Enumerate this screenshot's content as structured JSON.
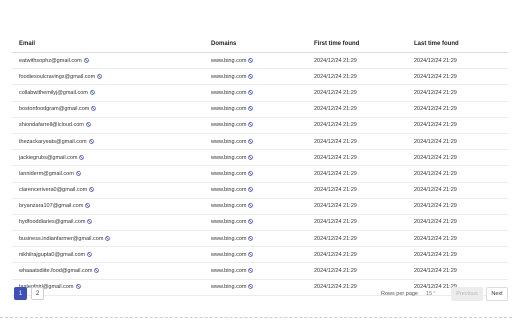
{
  "table": {
    "headers": {
      "email": "Email",
      "domains": "Domains",
      "first": "First time found",
      "last": "Last time found"
    },
    "rows": [
      {
        "email": "eatwithsophz@gmail.com",
        "domain": "www.bing.com",
        "first": "2024/12/24 21:29",
        "last": "2024/12/24 21:29"
      },
      {
        "email": "foodiesoulcravings@gmail.com",
        "domain": "www.bing.com",
        "first": "2024/12/24 21:29",
        "last": "2024/12/24 21:29"
      },
      {
        "email": "collabwithemilyj@gmail.com",
        "domain": "www.bing.com",
        "first": "2024/12/24 21:29",
        "last": "2024/12/24 21:29"
      },
      {
        "email": "bostonfoodgram@gmail.com",
        "domain": "www.bing.com",
        "first": "2024/12/24 21:29",
        "last": "2024/12/24 21:29"
      },
      {
        "email": "shiondafarrell@icloud.com",
        "domain": "www.bing.com",
        "first": "2024/12/24 21:29",
        "last": "2024/12/24 21:29"
      },
      {
        "email": "thezackaryeats@gmail.com",
        "domain": "www.bing.com",
        "first": "2024/12/24 21:29",
        "last": "2024/12/24 21:29"
      },
      {
        "email": "jackiegrubs@gmail.com",
        "domain": "www.bing.com",
        "first": "2024/12/24 21:29",
        "last": "2024/12/24 21:29"
      },
      {
        "email": "lanniderm@gmail.com",
        "domain": "www.bing.com",
        "first": "2024/12/24 21:29",
        "last": "2024/12/24 21:29"
      },
      {
        "email": "clarencerivera0@gmail.com",
        "domain": "www.bing.com",
        "first": "2024/12/24 21:29",
        "last": "2024/12/24 21:29"
      },
      {
        "email": "bryanzara107@gmail.com",
        "domain": "www.bing.com",
        "first": "2024/12/24 21:29",
        "last": "2024/12/24 21:29"
      },
      {
        "email": "hydfooddiaries@gmail.com",
        "domain": "www.bing.com",
        "first": "2024/12/24 21:29",
        "last": "2024/12/24 21:29"
      },
      {
        "email": "business.indianfarmer@gmail.com",
        "domain": "www.bing.com",
        "first": "2024/12/24 21:29",
        "last": "2024/12/24 21:29"
      },
      {
        "email": "nikhilrajgupta0@gmail.com",
        "domain": "www.bing.com",
        "first": "2024/12/24 21:29",
        "last": "2024/12/24 21:29"
      },
      {
        "email": "whaaatsdiite.food@gmail.com",
        "domain": "www.bing.com",
        "first": "2024/12/24 21:29",
        "last": "2024/12/24 21:29"
      },
      {
        "email": "tasteofgirl@gmail.com",
        "domain": "www.bing.com",
        "first": "2024/12/24 21:29",
        "last": "2024/12/24 21:29"
      }
    ]
  },
  "pagination": {
    "pages": [
      "1",
      "2"
    ],
    "current_page": "1",
    "rows_per_page_label": "Rows per page",
    "rows_per_page_value": "15",
    "previous_label": "Previous",
    "next_label": "Next"
  },
  "icons": {
    "row_action": "block-icon"
  },
  "colors": {
    "accent": "#3f51b5",
    "block_icon": "#3f51b5"
  }
}
